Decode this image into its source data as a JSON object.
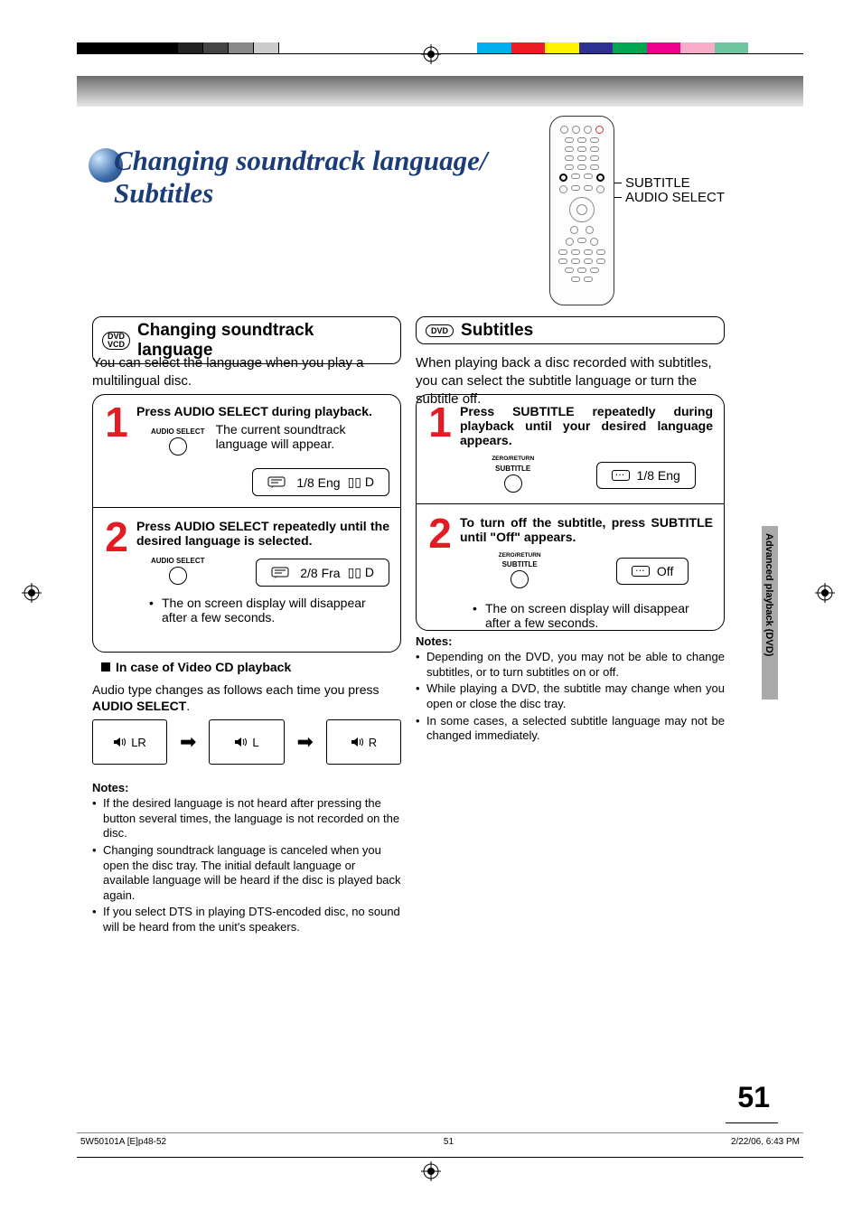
{
  "title_line1": "Changing soundtrack language/",
  "title_line2": "Subtitles",
  "remote_labels": {
    "subtitle": "SUBTITLE",
    "audio_select": "AUDIO SELECT"
  },
  "section_left": {
    "disc_types": [
      "DVD",
      "VCD"
    ],
    "heading": "Changing soundtrack language",
    "lead_in": "You can select the language when you play a multilingual disc.",
    "step1": {
      "num": "1",
      "title": "Press AUDIO SELECT during playback.",
      "btn_label": "AUDIO SELECT",
      "desc": "The current soundtrack language will appear.",
      "osd_text": "1/8 Eng",
      "osd_codec": "▯▯ D"
    },
    "step2": {
      "num": "2",
      "title": "Press AUDIO SELECT repeatedly until the desired language is selected.",
      "btn_label": "AUDIO SELECT",
      "osd_text": "2/8 Fra",
      "osd_codec": "▯▯ D"
    },
    "bullet": "The on screen display will disappear after a few seconds.",
    "vcd_head": "In case of Video CD playback",
    "vcd_text_1": "Audio type changes as follows each time you press ",
    "vcd_text_bold": "AUDIO SELECT",
    "vcd_text_2": ".",
    "cycle": [
      "LR",
      "L",
      "R"
    ],
    "notes_head": "Notes:",
    "notes": [
      "If the desired language is not heard after pressing the button several times, the language is not recorded on the disc.",
      "Changing soundtrack language is canceled when you open the disc tray. The initial default language or available language will be heard if the disc is played back again.",
      "If you select DTS in playing DTS-encoded disc, no sound will be heard from the unit's speakers."
    ]
  },
  "section_right": {
    "disc_types": [
      "DVD"
    ],
    "heading": "Subtitles",
    "lead_in": "When playing back a disc recorded with subtitles, you can select the subtitle language or turn the subtitle off.",
    "step1": {
      "num": "1",
      "title": "Press SUBTITLE repeatedly during playback until your desired language appears.",
      "btn_top": "ZERO/RETURN",
      "btn_label": "SUBTITLE",
      "osd_text": "1/8 Eng"
    },
    "step2": {
      "num": "2",
      "title": "To turn off the subtitle, press SUBTITLE until \"Off\" appears.",
      "btn_top": "ZERO/RETURN",
      "btn_label": "SUBTITLE",
      "osd_text": "Off"
    },
    "bullet": "The on screen display will disappear after a few seconds.",
    "notes_head": "Notes:",
    "notes": [
      "Depending on the DVD, you may not be able to change subtitles, or to turn subtitles on or off.",
      "While playing a DVD, the subtitle may change when you open or close the disc tray.",
      "In some cases, a selected subtitle language may not be changed immediately."
    ]
  },
  "side_tab": "Advanced playback (DVD)",
  "page_number": "51",
  "footer": {
    "left": "5W50101A [E]p48-52",
    "center": "51",
    "right": "2/22/06, 6:43 PM"
  }
}
